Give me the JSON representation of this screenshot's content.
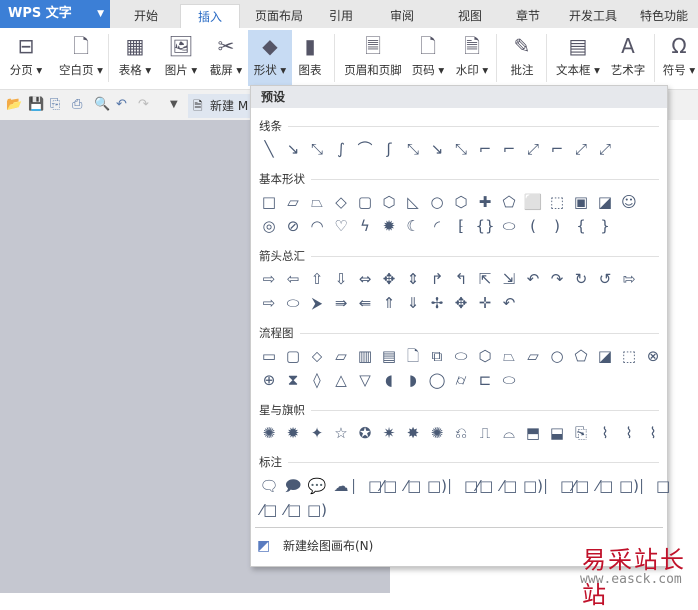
{
  "app": {
    "title": "WPS 文字"
  },
  "tabs": [
    "开始",
    "插入",
    "页面布局",
    "引用",
    "审阅",
    "视图",
    "章节",
    "开发工具",
    "特色功能"
  ],
  "active_tab": "插入",
  "ribbon": [
    {
      "label": "分页 ▾",
      "icon": "⊟"
    },
    {
      "label": "空白页 ▾",
      "icon": "🗋"
    },
    {
      "label": "表格 ▾",
      "icon": "▦"
    },
    {
      "label": "图片 ▾",
      "icon": "🖼"
    },
    {
      "label": "截屏 ▾",
      "icon": "✂"
    },
    {
      "label": "形状 ▾",
      "icon": "◆"
    },
    {
      "label": "图表",
      "icon": "▮"
    },
    {
      "label": "页眉和页脚",
      "icon": "🗏"
    },
    {
      "label": "页码 ▾",
      "icon": "🗋"
    },
    {
      "label": "水印 ▾",
      "icon": "🗎"
    },
    {
      "label": "批注",
      "icon": "✎"
    },
    {
      "label": "文本框 ▾",
      "icon": "▤"
    },
    {
      "label": "艺术字",
      "icon": "A"
    },
    {
      "label": "符号 ▾",
      "icon": "Ω"
    }
  ],
  "document_tab": "新建 M",
  "shapes_menu": {
    "header": "预设",
    "sections": [
      {
        "title": "线条",
        "rows": [
          [
            "╲",
            "↘",
            "⤡",
            "∫",
            "⌒",
            "ʃ",
            "⤡",
            "↘",
            "⤡",
            "⌐",
            "⌐",
            "⤢",
            "⌐",
            "⤢",
            "⤢"
          ]
        ]
      },
      {
        "title": "基本形状",
        "rows": [
          [
            "□",
            "▱",
            "⏢",
            "◇",
            "▢",
            "⬡",
            "◺",
            "○",
            "⬡",
            "✚",
            "⬠",
            "⬜",
            "⬚",
            "▣",
            "◪",
            "☺"
          ],
          [
            "◎",
            "⊘",
            "◠",
            "♡",
            "ϟ",
            "✹",
            "☾",
            "◜",
            "⁅",
            "{}",
            "⬭",
            "(",
            ")",
            "{",
            "}"
          ]
        ]
      },
      {
        "title": "箭头总汇",
        "rows": [
          [
            "⇨",
            "⇦",
            "⇧",
            "⇩",
            "⇔",
            "✥",
            "⇕",
            "↱",
            "↰",
            "⇱",
            "⇲",
            "↶",
            "↷",
            "↻",
            "↺",
            "⇰"
          ],
          [
            "⇨",
            "⬭",
            "⮞",
            "⇛",
            "⇚",
            "⇑",
            "⇓",
            "✢",
            "✥",
            "✛",
            "↶"
          ]
        ]
      },
      {
        "title": "流程图",
        "rows": [
          [
            "▭",
            "▢",
            "⬦",
            "▱",
            "▥",
            "▤",
            "🗋",
            "⧉",
            "⬭",
            "⬡",
            "⏢",
            "⏥",
            "○",
            "⬠",
            "◪",
            "⬚",
            "⊗"
          ],
          [
            "⊕",
            "⧗",
            "◊",
            "△",
            "▽",
            "◖",
            "◗",
            "◯",
            "⌭",
            "⊏",
            "⬭"
          ]
        ]
      },
      {
        "title": "星与旗帜",
        "rows": [
          [
            "✺",
            "✹",
            "✦",
            "☆",
            "✪",
            "✷",
            "✸",
            "✺",
            "⎌",
            "⎍",
            "⌓",
            "⬒",
            "⬓",
            "⎘",
            "⌇",
            "⌇",
            "⌇"
          ]
        ]
      },
      {
        "title": "标注",
        "rows": [
          [
            "🗨",
            "🗩",
            "💬",
            "☁",
            "⎸□",
            "⁄□",
            "⁄□",
            "□)",
            "⎸□",
            "⁄□",
            "⁄□",
            "□)",
            "⎸□",
            "⁄□",
            "⁄□",
            "□)",
            "⎸□"
          ],
          [
            "⁄□",
            "⁄□",
            "□)"
          ]
        ]
      }
    ],
    "new_canvas": "新建绘图画布(N)"
  },
  "watermark": {
    "text": "易采站长站",
    "url": "www.easck.com"
  }
}
